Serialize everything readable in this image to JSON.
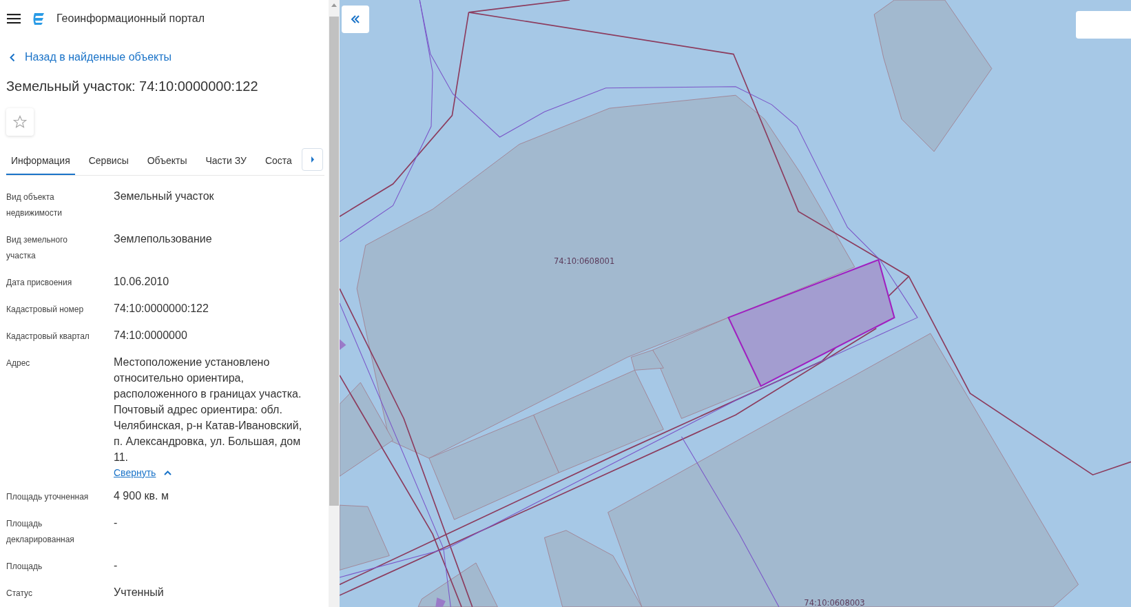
{
  "header": {
    "title": "Геоинформационный портал"
  },
  "back_link": "Назад в найденные объекты",
  "heading": "Земельный участок: 74:10:0000000:122",
  "favorite": {
    "on": false
  },
  "tabs": [
    {
      "label": "Информация",
      "selected": true
    },
    {
      "label": "Сервисы",
      "selected": false
    },
    {
      "label": "Объекты",
      "selected": false
    },
    {
      "label": "Части ЗУ",
      "selected": false
    },
    {
      "label": "Соста",
      "selected": false
    }
  ],
  "fields": [
    {
      "label": "Вид объекта недвижимости",
      "value": "Земельный участок"
    },
    {
      "label": "Вид земельного участка",
      "value": "Землепользование"
    },
    {
      "label": "Дата присвоения",
      "value": "10.06.2010"
    },
    {
      "label": "Кадастровый номер",
      "value": "74:10:0000000:122"
    },
    {
      "label": "Кадастровый квартал",
      "value": "74:10:0000000"
    },
    {
      "label": "Адрес",
      "value": "Местоположение установлено относительно ориентира, расположенного в границах участка. Почтовый адрес ориентира: обл. Челябинская, р-н Катав-Ивановский, п. Александровка, ул. Большая, дом 11.",
      "toggle": {
        "label": "Свернуть",
        "expanded": true
      }
    },
    {
      "label": "Площадь уточненная",
      "value": "4 900 кв. м"
    },
    {
      "label": "Площадь декларированная",
      "value": "-"
    },
    {
      "label": "Площадь",
      "value": "-"
    },
    {
      "label": "Статус",
      "value": "Учтенный"
    }
  ],
  "map": {
    "labels": [
      "74:10:0608001",
      "74:10:0608003"
    ]
  }
}
